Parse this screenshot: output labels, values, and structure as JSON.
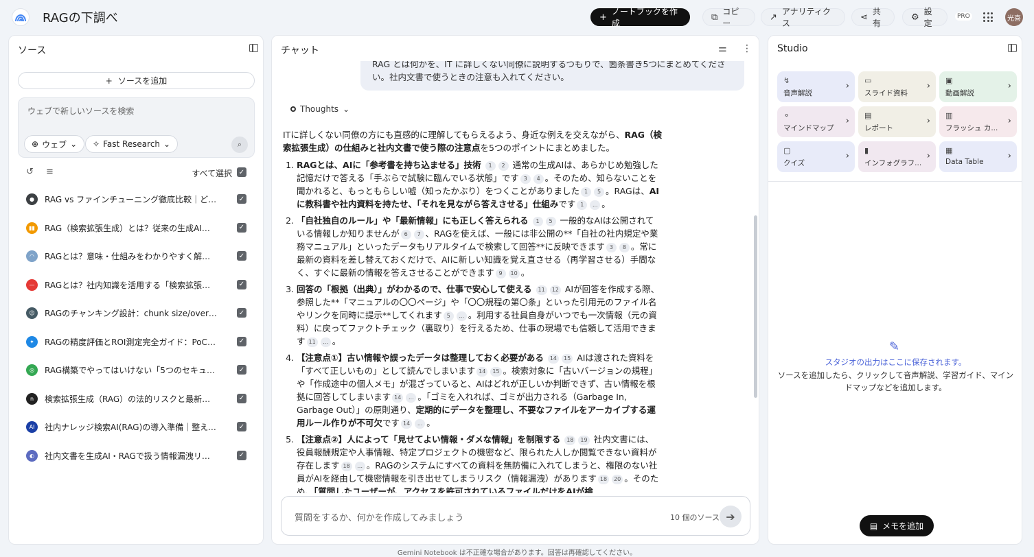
{
  "header": {
    "title": "RAGの下調べ",
    "create_notebook": "ノートブックを作成",
    "copy": "コピー",
    "analytics": "アナリティクス",
    "share": "共有",
    "settings": "設定",
    "pro_badge": "PRO",
    "avatar_text": "光喜"
  },
  "sources": {
    "title": "ソース",
    "add_source": "ソースを追加",
    "search_placeholder": "ウェブで新しいソースを検索",
    "web_chip": "ウェブ",
    "research_chip": "Fast Research",
    "select_all": "すべて選択",
    "items": [
      {
        "label": "RAG vs ファインチューニング徹底比較｜どちら...",
        "color": "#3c4043",
        "glyph": "●"
      },
      {
        "label": "RAG（検索拡張生成）とは？従来の生成AIとの違...",
        "color": "#f29900",
        "glyph": "▮▮"
      },
      {
        "label": "RAGとは？意味・仕組みをわかりやすく解説 | ブ...",
        "color": "#7fa3c9",
        "glyph": "◠"
      },
      {
        "label": "RAGとは？社内知識を活用する「検索拡張生成」...",
        "color": "#e53935",
        "glyph": "—"
      },
      {
        "label": "RAGのチャンキング設計：chunk size/overlapと...",
        "color": "#455a64",
        "glyph": "☺"
      },
      {
        "label": "RAGの精度評価とROI測定完全ガイド：PoC脱却...",
        "color": "#1e88e5",
        "glyph": "✦"
      },
      {
        "label": "RAG構築でやってはいけない「5つのセキュリテ...",
        "color": "#34a853",
        "glyph": "◎"
      },
      {
        "label": "検索拡張生成（RAG）の法的リスクと最新動向 | ...",
        "color": "#222222",
        "glyph": "n"
      },
      {
        "label": "社内ナレッジ検索AI(RAG)の導入準備｜整えるべ...",
        "color": "#1a3fa6",
        "glyph": "AI"
      },
      {
        "label": "社内文書を生成AI・RAGで扱う情報漏洩リスクと...",
        "color": "#5c6bc0",
        "glyph": "◐"
      }
    ]
  },
  "chat": {
    "title": "チャット",
    "user_message": "RAG とは何かを、IT に詳しくない同僚に説明するつもりで、箇条書き5つにまとめてください。社内文書で使うときの注意も入れてください。",
    "thoughts": "Thoughts",
    "intro_1": "ITに詳しくない同僚の方にも直感的に理解してもらえるよう、身近な例えを交えながら、",
    "intro_bold": "RAG（検索拡張生成）の仕組みと社内文書で使う際の注意点",
    "intro_2": "を5つのポイントにまとめました。",
    "p1_bold": "RAGとは、AIに「参考書を持ち込ませる」技術",
    "p1_text": "通常の生成AIは、あらかじめ勉強した記憶だけで答える「手ぶらで試験に臨んでいる状態」です",
    "p1_text2": "。そのため、知らないことを聞かれると、もっともらしい嘘（知ったかぶり）をつくことがありました",
    "p1_text3": "。RAGは、",
    "p1_bold2": "AIに教科書や社内資料を持たせ、「それを見ながら答えさせる」仕組み",
    "p1_text4": "です",
    "p2_bold": "「自社独自のルール」や「最新情報」にも正しく答えられる",
    "p2_text": "一般的なAIは公開されている情報しか知りませんが",
    "p2_text2": "、RAGを使えば、一般には非公開の**「自社の社内規定や業務マニュアル」といったデータもリアルタイムで検索して回答**に反映できます",
    "p2_text3": "。常に最新の資料を差し替えておくだけで、AIに新しい知識を覚え直させる（再学習させる）手間なく、すぐに最新の情報を答えさせることができます",
    "p3_bold": "回答の「根拠（出典）」がわかるので、仕事で安心して使える",
    "p3_text": "AIが回答を作成する際、参照した**「マニュアルの〇〇ページ」や「〇〇規程の第〇条」といった引用元のファイル名やリンクを同時に提示**してくれます",
    "p3_text2": "。利用する社員自身がいつでも一次情報（元の資料）に戻ってファクトチェック（裏取り）を行えるため、仕事の現場でも信頼して活用できます",
    "p4_bold": "【注意点①】古い情報や誤ったデータは整理しておく必要がある",
    "p4_text": "AIは渡された資料を「すべて正しいもの」として読んでしまいます",
    "p4_text2": "。検索対象に「古いバージョンの規程」や「作成途中の個人メモ」が混ざっていると、AIはどれが正しいか判断できず、古い情報を根拠に回答してしまいます",
    "p4_text3": "。「ゴミを入れれば、ゴミが出力される（Garbage In, Garbage Out）」の原則通り、",
    "p4_bold2": "定期的にデータを整理し、不要なファイルをアーカイブする運用ルール作りが不可欠",
    "p4_text4": "です",
    "p5_bold": "【注意点②】人によって「見せてよい情報・ダメな情報」を制限する",
    "p5_text": "社内文書には、役員報酬規定や人事情報、特定プロジェクトの機密など、限られた人しか閲覧できない資料が存在します",
    "p5_text2": "。RAGのシステムにすべての資料を無防備に入れてしまうと、権限のない社員がAIを経由して機密情報を引き出せてしまうリスク（情報漏洩）があります",
    "p5_text3": "。そのため、",
    "p5_bold2": "「質問したユーザーが、アクセスを許可されているファイルだけをAIが検",
    "composer_placeholder": "質問をするか、何かを作成してみましょう",
    "source_count": "10 個のソース"
  },
  "studio": {
    "title": "Studio",
    "tiles": [
      {
        "label": "音声解説",
        "icon": "↯",
        "bg": "#e8ebf9"
      },
      {
        "label": "スライド資料",
        "icon": "▭",
        "bg": "#f1efe6"
      },
      {
        "label": "動画解説",
        "icon": "▣",
        "bg": "#e4f2e8"
      },
      {
        "label": "マインドマップ",
        "icon": "⚬",
        "bg": "#f1e8f0"
      },
      {
        "label": "レポート",
        "icon": "▤",
        "bg": "#f1efe6"
      },
      {
        "label": "フラッシュ カ...",
        "icon": "▥",
        "bg": "#f6e9ec"
      },
      {
        "label": "クイズ",
        "icon": "▢",
        "bg": "#e8ebf9"
      },
      {
        "label": "インフォグラフ...",
        "icon": "▮",
        "bg": "#f1e8f0"
      },
      {
        "label": "Data Table",
        "icon": "▦",
        "bg": "#e8ebf9"
      }
    ],
    "empty_title": "スタジオの出力はここに保存されます。",
    "empty_desc": "ソースを追加したら、クリックして音声解説、学習ガイド、マインドマップなどを追加します。",
    "memo_button": "メモを追加"
  },
  "footer": "Gemini Notebook は不正確な場合があります。回答は再確認してください。",
  "citations": {
    "p1": [
      "1",
      "2",
      "3",
      "4",
      "1",
      "5",
      "1",
      "..."
    ],
    "p2": [
      "1",
      "5",
      "6",
      "7",
      "3",
      "8",
      "9",
      "10"
    ],
    "p3": [
      "11",
      "12",
      "5",
      "...",
      "11",
      "..."
    ],
    "p4": [
      "14",
      "15",
      "14",
      "15",
      "14",
      "...",
      "14",
      "..."
    ],
    "p5": [
      "18",
      "19",
      "18",
      "...",
      "18",
      "20"
    ]
  }
}
